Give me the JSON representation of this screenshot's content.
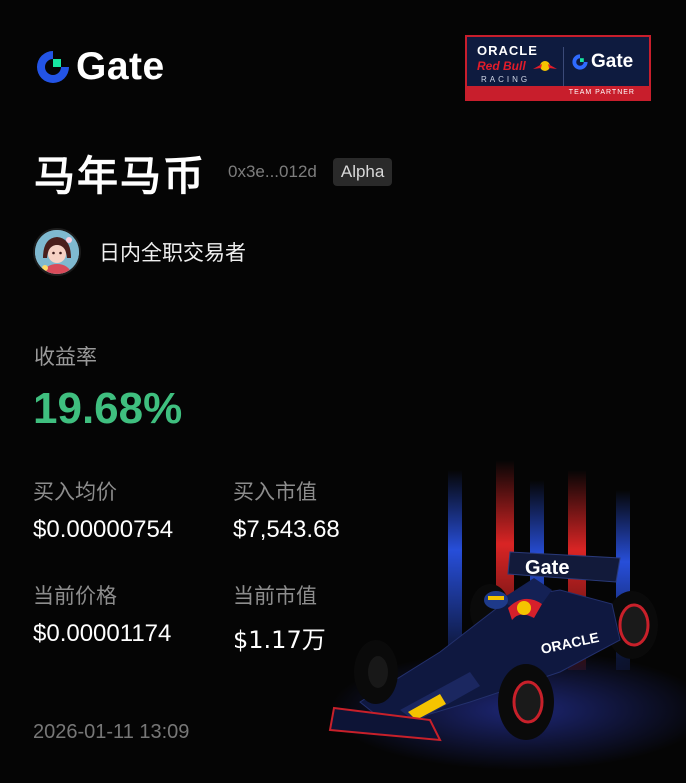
{
  "brand": {
    "name": "Gate"
  },
  "partner": {
    "oracle": "ORACLE",
    "redbull": "Red Bull",
    "racing": "RACING",
    "gate": "Gate",
    "team_partner": "TEAM PARTNER"
  },
  "token": {
    "name": "马年马币",
    "address": "0x3e...012d",
    "badge": "Alpha"
  },
  "user": {
    "name": "日内全职交易者"
  },
  "yield": {
    "label": "收益率",
    "value": "19.68%"
  },
  "stats": {
    "avg_buy_price_label": "买入均价",
    "avg_buy_price": "$0.00000754",
    "buy_value_label": "买入市值",
    "buy_value": "$7,543.68",
    "current_price_label": "当前价格",
    "current_price": "$0.00001174",
    "current_value_label": "当前市值",
    "current_value": "$1.17万"
  },
  "timestamp": "2026-01-11 13:09",
  "art": {
    "car_livery_text": "Gate",
    "sidepod_text": "ORACLE"
  },
  "colors": {
    "accent_green": "#3fbf7f",
    "brand_blue": "#2354e6",
    "brand_green": "#17e6a1",
    "redbull_red": "#e21c2a",
    "navy": "#0e1b3f"
  }
}
